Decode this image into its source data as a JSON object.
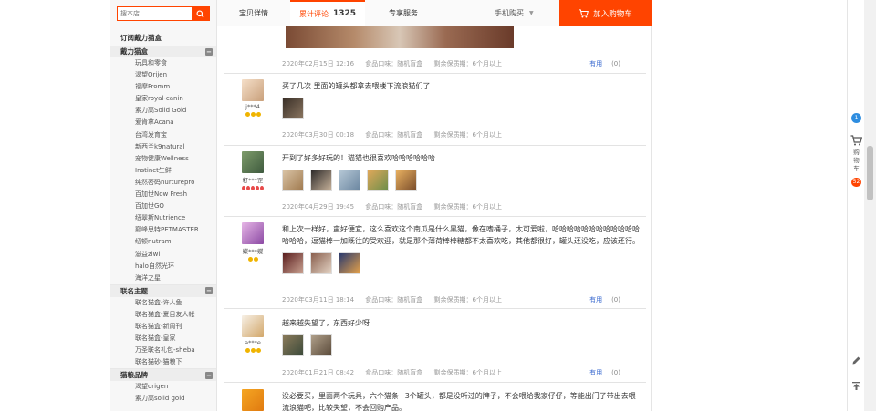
{
  "search": {
    "placeholder": "搜本店"
  },
  "sidebar": {
    "title": "订阅戴力猫盒",
    "groups": [
      {
        "label": "戴力猫盒",
        "items": [
          "玩具和零食",
          "渴望Orijen",
          "福摩Fromm",
          "皇家royal-canin",
          "素力高Solid Gold",
          "爱肯拿Acana",
          "台湾发育宝",
          "新西兰k9natural",
          "宠物健康Wellness",
          "Instinct生鲜",
          "纯然密码nurturepro",
          "百加世Now Fresh",
          "百加世GO",
          "纽翠斯Nutrience",
          "巅峰思特PETMASTER",
          "纽顿nutram",
          "滋益ziwi",
          "halo自然光环",
          "海洋之星"
        ]
      },
      {
        "label": "联名主题",
        "items": [
          "联名猫盒-许人鱼",
          "联名猫盒-夏目友人帐",
          "联名猫盒-新周刊",
          "联名猫盒-皇家",
          "万圣联名礼包-sheba",
          "联名猫砂-猫粮下"
        ]
      },
      {
        "label": "猫粮品牌",
        "items": [
          "渴望origen",
          "素力高solid gold"
        ]
      }
    ]
  },
  "tabs": {
    "detail": "宝贝详情",
    "reviews": "累计评论",
    "review_count": "1325",
    "service": "专享服务",
    "mobile_buy": "手机购买",
    "add_to_cart": "加入购物车"
  },
  "reviews": [
    {
      "nick": "",
      "date": "2020年02月15日 12:16",
      "taste": "食品口味：随机盲盒",
      "shelf": "剩余保质期：6个月以上",
      "useful": "有用",
      "useful_count": "(0)",
      "text": ""
    },
    {
      "nick": "j***4",
      "date": "2020年03月30日 00:18",
      "taste": "食品口味：随机盲盒",
      "shelf": "剩余保质期：6个月以上",
      "useful": "有用",
      "useful_count": "(0)",
      "text": "买了几次 里面的罐头都拿去喂楼下流浪猫们了"
    },
    {
      "nick": "籽***罡",
      "date": "2020年04月29日 19:45",
      "taste": "食品口味：随机盲盒",
      "shelf": "剩余保质期：6个月以上",
      "useful": "有用",
      "useful_count": "(0)",
      "text": "开到了好多好玩的！猫猫也很喜欢哈哈哈哈哈哈"
    },
    {
      "nick": "蝶***蝶",
      "date": "2020年03月11日 18:14",
      "taste": "食品口味：随机盲盒",
      "shelf": "剩余保质期：6个月以上",
      "useful": "有用",
      "useful_count": "(0)",
      "text": "和上次一样好，蛮好便宜，这么喜欢这个南瓜是什么黑猫，像在嗜桶子，太可爱啦，哈哈哈哈哈哈哈哈哈哈哈哈哈哈哈，逗猫棒一加既往的受欢迎，就是那个薄荷棒棒糖都不太喜欢吃，其他都很好，罐头还没吃，应该还行。"
    },
    {
      "nick": "a***e",
      "date": "2020年01月21日 08:42",
      "taste": "食品口味：随机盲盒",
      "shelf": "剩余保质期：6个月以上",
      "useful": "有用",
      "useful_count": "(0)",
      "text": "越来越失望了，东西好少呀"
    },
    {
      "nick": "",
      "date": "",
      "taste": "",
      "shelf": "",
      "useful": "",
      "useful_count": "",
      "text": "没必要买，里面两个玩具，六个猫条+3个罐头，都是没听过的牌子，不会喂给我家仔仔，等能出门了带出去喂流浪猫吧，比较失望，不会回购产品。"
    }
  ],
  "rightbar": {
    "badge": "1",
    "cart_label": "购物车",
    "cart_count": "52"
  },
  "icons": [
    "search-icon",
    "cart-icon",
    "chevron-down-icon",
    "collapse-icon",
    "edit-icon",
    "back-to-top-icon"
  ],
  "colors": {
    "accent": "#ff4400",
    "link": "#3f6ed1",
    "badge_blue": "#2e8de0"
  }
}
